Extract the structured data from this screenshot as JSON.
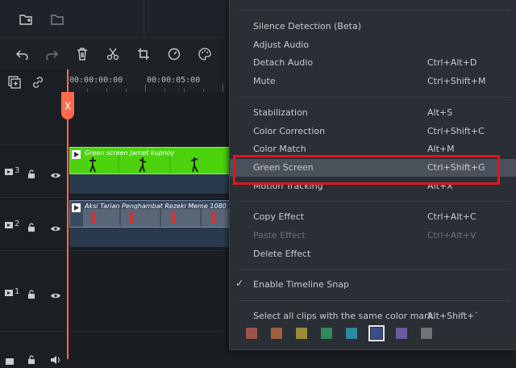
{
  "ruler": {
    "t0": "00:00:00:00",
    "t1": "00:00:05:00"
  },
  "tracks": [
    {
      "number": "3"
    },
    {
      "number": "2"
    },
    {
      "number": "1"
    }
  ],
  "clips": {
    "green": {
      "title": "Green screen Jamet kupnoy"
    },
    "video": {
      "title": "Aksi Tarian Penghambat Rezeki Meme 1080"
    }
  },
  "menu": {
    "items": [
      {
        "label": "Silence Detection (Beta)",
        "shortcut": ""
      },
      {
        "label": "Adjust Audio",
        "shortcut": ""
      },
      {
        "label": "Detach Audio",
        "shortcut": "Ctrl+Alt+D"
      },
      {
        "label": "Mute",
        "shortcut": "Ctrl+Shift+M"
      },
      {
        "label": "Stabilization",
        "shortcut": "Alt+S"
      },
      {
        "label": "Color Correction",
        "shortcut": "Ctrl+Shift+C"
      },
      {
        "label": "Color Match",
        "shortcut": "Alt+M"
      },
      {
        "label": "Green Screen",
        "shortcut": "Ctrl+Shift+G"
      },
      {
        "label": "Motion Tracking",
        "shortcut": "Alt+X"
      },
      {
        "label": "Copy Effect",
        "shortcut": "Ctrl+Alt+C"
      },
      {
        "label": "Paste Effect",
        "shortcut": "Ctrl+Alt+V"
      },
      {
        "label": "Delete Effect",
        "shortcut": ""
      },
      {
        "label": "Enable Timeline Snap",
        "shortcut": ""
      },
      {
        "label": "Select all clips with the same color mark",
        "shortcut": "Alt+Shift+`"
      }
    ],
    "highlighted": "Green Screen",
    "color_marks": [
      "#a0504e",
      "#a06042",
      "#9a8c3a",
      "#2f8a5a",
      "#2a8aa0",
      "#3a4d8a",
      "#6a5aa0",
      "#707478"
    ],
    "selected_color_index": 5
  }
}
